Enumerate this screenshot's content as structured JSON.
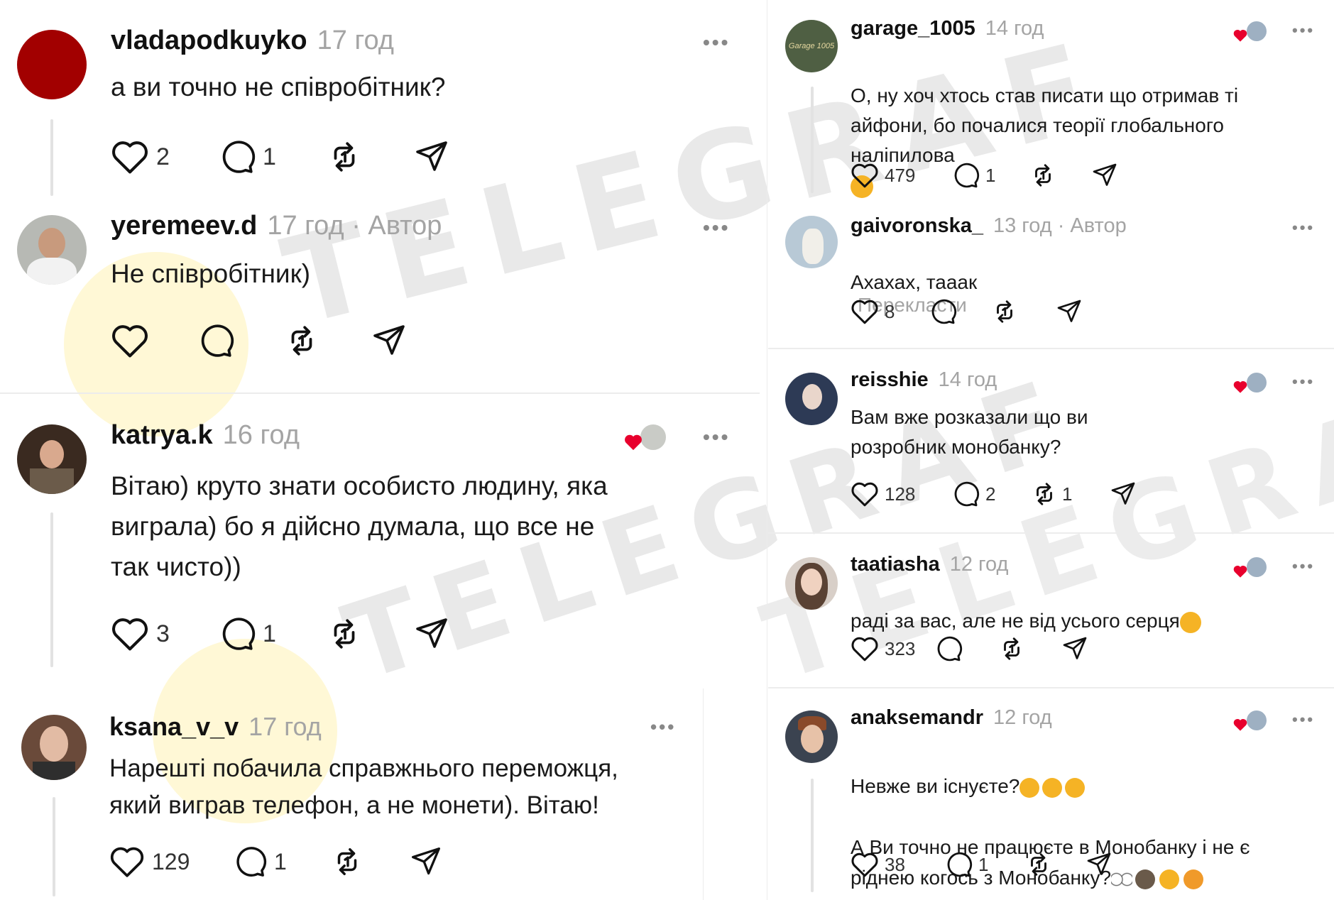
{
  "watermark": "TELEGRAF",
  "left": {
    "posts": [
      {
        "username": "vladapodkuyko",
        "time": "17 год",
        "author": "",
        "text": "а ви точно не співробітник?",
        "likes": "2",
        "comments": "1",
        "reposts": ""
      },
      {
        "username": "yeremeev.d",
        "time": "17 год",
        "author": " · Автор",
        "text": "Не співробітник)",
        "likes": "",
        "comments": "",
        "reposts": ""
      },
      {
        "username": "katrya.k",
        "time": "16 год",
        "author": "",
        "text": "Вітаю) круто знати особисто людину, яка\nвиграла) бо я дійсно думала, що все не\nтак чисто))",
        "likes": "3",
        "comments": "1",
        "reposts": ""
      },
      {
        "username": "ksana_v_v",
        "time": "17 год",
        "author": "",
        "text": "Нарешті побачила справжнього переможця,\nякий виграв телефон, а не монети). Вітаю!",
        "likes": "129",
        "comments": "1",
        "reposts": ""
      }
    ]
  },
  "right": {
    "posts": [
      {
        "username": "garage_1005",
        "time": "14 год",
        "author": "",
        "text": "О, ну хоч хтось став писати що отримав ті\nайфони, бо почалися теорії глобального\nналіпилова",
        "likes": "479",
        "comments": "1",
        "reposts": "",
        "avatar_text": "Garage 1005"
      },
      {
        "username": "gaivoronska_",
        "time": "13 год",
        "author": " · Автор",
        "text": "Ахахах, тааак",
        "translate": "Перекласти",
        "likes": "8",
        "comments": "",
        "reposts": ""
      },
      {
        "username": "reisshie",
        "time": "14 год",
        "author": "",
        "text": "Вам вже розказали що ви\nрозробник монобанку?",
        "likes": "128",
        "comments": "2",
        "reposts": "1"
      },
      {
        "username": "taatiasha",
        "time": "12 год",
        "author": "",
        "text": "раді за вас, але не від усього серця",
        "likes": "323",
        "comments": "",
        "reposts": ""
      },
      {
        "username": "anaksemandr",
        "time": "12 год",
        "author": "",
        "text": "Невже ви існуєте?",
        "text2": "А Ви точно не працюєте в Монобанку і не є\nріднею когось з Монобанку?",
        "likes": "38",
        "comments": "1",
        "reposts": ""
      }
    ]
  },
  "icons": {
    "more": "•••",
    "heart": "heart-icon",
    "comment": "comment-icon",
    "repost": "repost-icon",
    "share": "share-icon"
  },
  "colors": {
    "like_red": "#e8002d",
    "muted": "#a4a4a4",
    "divider": "#ececec"
  }
}
